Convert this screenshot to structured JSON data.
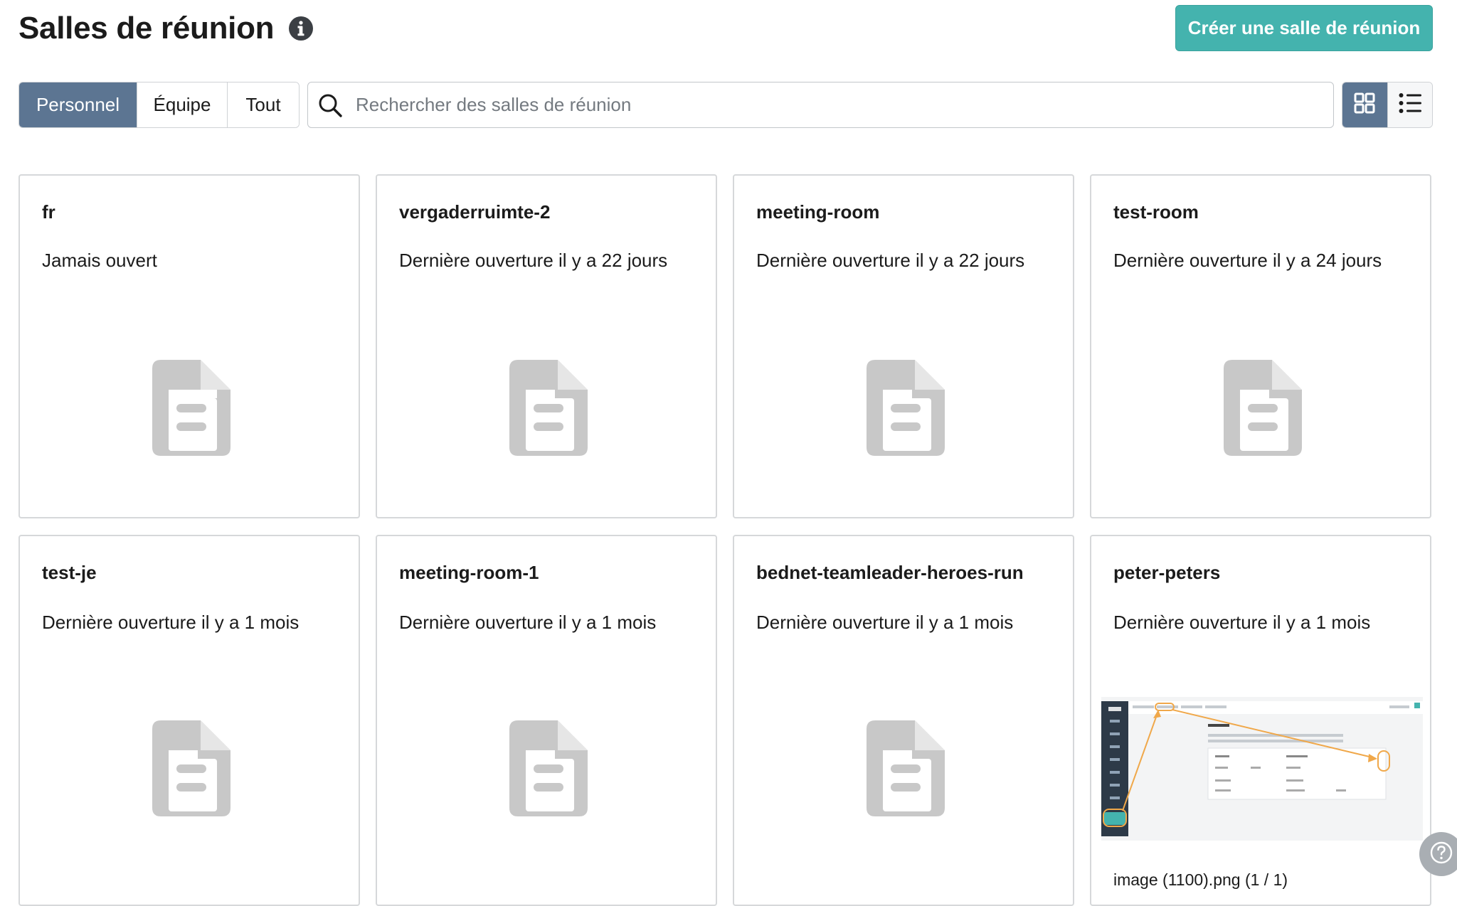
{
  "header": {
    "title": "Salles de réunion",
    "info_icon": "info-circle-icon",
    "create_button_label": "Créer une salle de réunion"
  },
  "filters": {
    "tabs": [
      {
        "label": "Personnel",
        "active": true
      },
      {
        "label": "Équipe",
        "active": false
      },
      {
        "label": "Tout",
        "active": false
      }
    ]
  },
  "search": {
    "placeholder": "Rechercher des salles de réunion",
    "value": "",
    "icon": "search-icon"
  },
  "view_toggle": {
    "options": [
      {
        "icon": "grid-view-icon",
        "active": true
      },
      {
        "icon": "list-view-icon",
        "active": false
      }
    ]
  },
  "rooms": [
    {
      "name": "fr",
      "status": "Jamais ouvert",
      "thumbnail": "document-icon"
    },
    {
      "name": "vergaderruimte-2",
      "status": "Dernière ouverture il y a 22 jours",
      "thumbnail": "document-icon"
    },
    {
      "name": "meeting-room",
      "status": "Dernière ouverture il y a 22 jours",
      "thumbnail": "document-icon"
    },
    {
      "name": "test-room",
      "status": "Dernière ouverture il y a 24 jours",
      "thumbnail": "document-icon"
    },
    {
      "name": "test-je",
      "status": "Dernière ouverture il y a 1 mois",
      "thumbnail": "document-icon"
    },
    {
      "name": "meeting-room-1",
      "status": "Dernière ouverture il y a 1 mois",
      "thumbnail": "document-icon"
    },
    {
      "name": "bednet-teamleader-heroes-run",
      "status": "Dernière ouverture il y a 1 mois",
      "thumbnail": "document-icon"
    },
    {
      "name": "peter-peters",
      "status": "Dernière ouverture il y a 1 mois",
      "thumbnail": "image-preview",
      "caption": "image (1100).png (1 / 1)"
    }
  ],
  "help": {
    "icon": "help-circle-icon"
  },
  "colors": {
    "accent": "#44b3ae",
    "active_segment": "#5c7592",
    "card_border": "#d6d8da",
    "doc_icon": "#c8c8c8",
    "annotation_orange": "#f0a84a"
  }
}
